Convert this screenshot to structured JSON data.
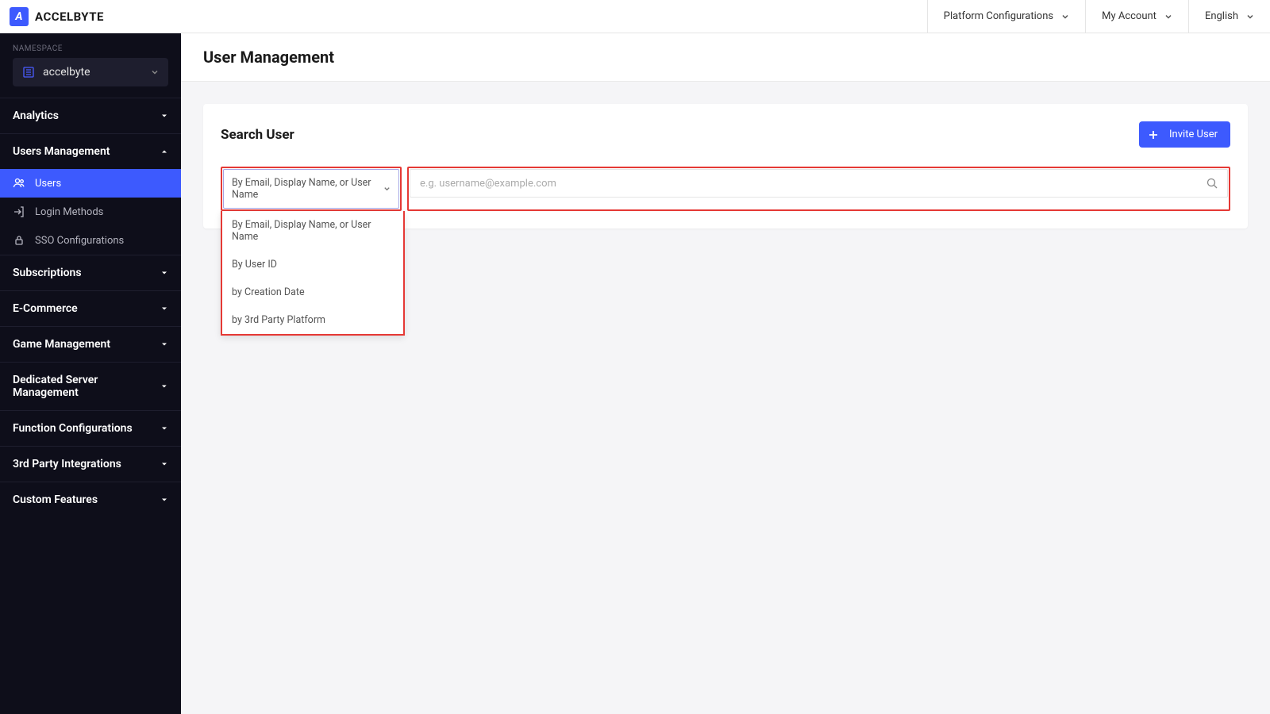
{
  "brand": "ACCELBYTE",
  "topNav": {
    "platformConfig": "Platform Configurations",
    "myAccount": "My Account",
    "language": "English"
  },
  "sidebar": {
    "nsLabel": "NAMESPACE",
    "nsValue": "accelbyte",
    "sections": [
      {
        "label": "Analytics",
        "expanded": false
      },
      {
        "label": "Users Management",
        "expanded": true,
        "items": [
          {
            "label": "Users",
            "active": true,
            "icon": "users"
          },
          {
            "label": "Login Methods",
            "active": false,
            "icon": "login"
          },
          {
            "label": "SSO Configurations",
            "active": false,
            "icon": "lock"
          }
        ]
      },
      {
        "label": "Subscriptions",
        "expanded": false
      },
      {
        "label": "E-Commerce",
        "expanded": false
      },
      {
        "label": "Game Management",
        "expanded": false
      },
      {
        "label": "Dedicated Server Management",
        "expanded": false
      },
      {
        "label": "Function Configurations",
        "expanded": false
      },
      {
        "label": "3rd Party Integrations",
        "expanded": false
      },
      {
        "label": "Custom Features",
        "expanded": false
      }
    ]
  },
  "page": {
    "title": "User Management",
    "cardTitle": "Search User",
    "inviteLabel": "Invite User",
    "filterSelected": "By Email, Display Name, or User Name",
    "searchPlaceholder": "e.g. username@example.com",
    "filterOptions": [
      "By Email, Display Name, or User Name",
      "By User ID",
      "by Creation Date",
      "by 3rd Party Platform"
    ]
  }
}
